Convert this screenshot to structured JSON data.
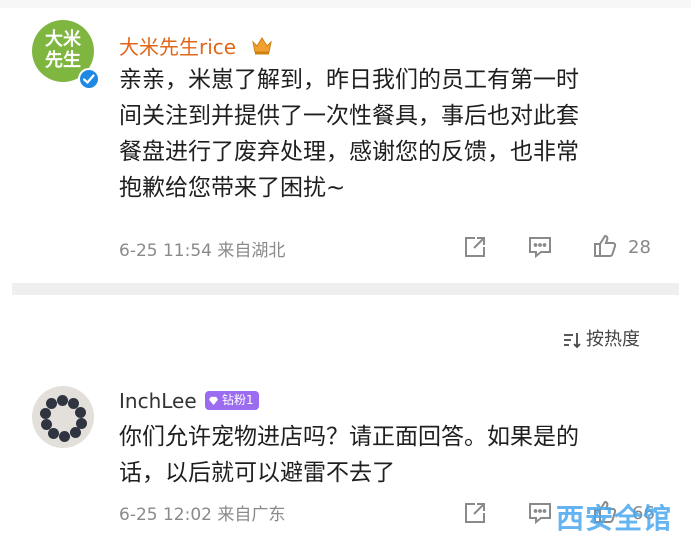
{
  "comments": [
    {
      "avatar_text": "大米先生",
      "username": "大米先生rice",
      "lines": [
        "亲亲，米崽了解到，昨日我们的员工有第一时",
        "间关注到并提供了一次性餐具，事后也对此套",
        "餐盘进行了废弃处理，感谢您的反馈，也非常",
        "抱歉给您带来了困扰~"
      ],
      "time": "6-25 11:54 来自湖北",
      "like_count": "28"
    },
    {
      "username": "InchLee",
      "badge": "钻粉1",
      "lines": [
        "你们允许宠物进店吗？请正面回答。如果是的",
        "话，以后就可以避雷不去了"
      ],
      "time": "6-25 12:02 来自广东",
      "like_count": "66"
    }
  ],
  "sort": {
    "label": "按热度"
  },
  "watermark": "西安全馆",
  "colors": {
    "brand_green": "#7fb640",
    "username_orange": "#e0671a",
    "badge_purple": "#9b6bf0",
    "verify_blue": "#1e88e5"
  }
}
